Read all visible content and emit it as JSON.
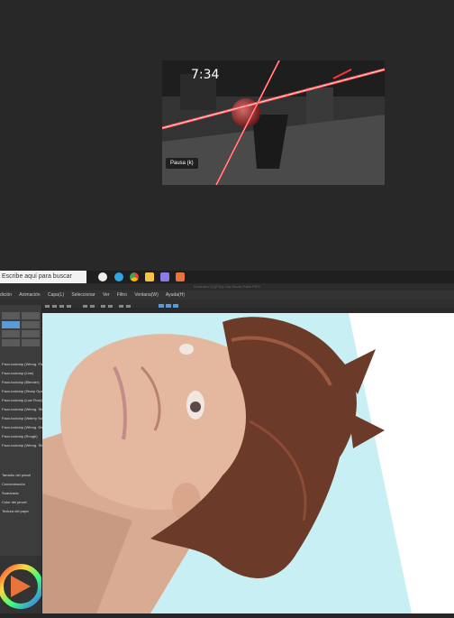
{
  "video": {
    "time": "7:34",
    "pause_label": "Pausa (k)"
  },
  "taskbar": {
    "search_placeholder": "Escribe aquí para buscar"
  },
  "app": {
    "title": "Illustration [1](Flip)-Clip Studio Paint PRO",
    "menu": [
      "dición",
      "Animación",
      "Capa(L)",
      "Seleccionar",
      "Ver",
      "Filtro",
      "Ventana(W)",
      "Ayuda(H)"
    ],
    "brushes": [
      "Faux-lockdop (Wbrng. Flat)",
      "Faux-lockdop (Line)",
      "Faux-lockdop (Blender)",
      "Faux-lockdop (Sharp Opaque)",
      "Faux-lockdop (Low Flow)",
      "Faux-lockdop (Wbrng. Sharp)",
      "Faux-lockdop (Watery Soft)",
      "Faux-lockdop (Wbrng. Deep)",
      "Faux-lockdop (Rough)",
      "Faux-lockdop (Wbrng. Sharp Fine)"
    ],
    "tool_props": [
      "Tamaño del pincel",
      "Concentración",
      "Suavizado",
      "Color del pincel",
      "Textura del papel"
    ],
    "colors": {
      "accent": "#5b9bd5",
      "canvas_bg": "#c8f0f4",
      "hair": "#6b3a28",
      "skin": "#e3b89f"
    }
  }
}
